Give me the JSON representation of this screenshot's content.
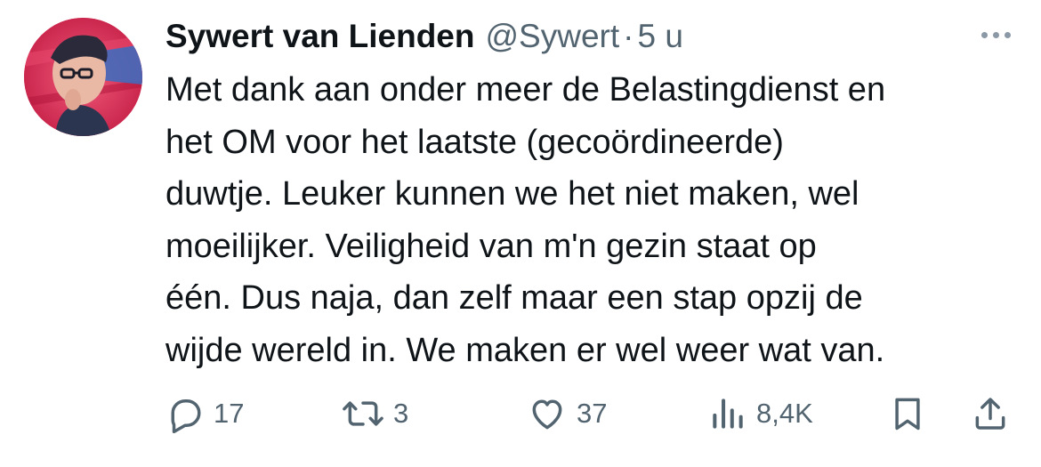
{
  "tweet": {
    "author_name": "Sywert van Lienden",
    "handle": "@Sywert",
    "separator": "·",
    "time": "5 u",
    "text_lines": [
      "Met dank aan onder meer de Belastingdienst en",
      "het OM voor het laatste (gecoördineerde)",
      "duwtje. Leuker kunnen we het niet maken, wel",
      "moeilijker. Veiligheid van m'n gezin staat op",
      "één. Dus naja, dan zelf maar een stap opzij de",
      "wijde wereld in. We maken er wel weer wat van."
    ]
  },
  "actions": {
    "replies": "17",
    "reposts": "3",
    "likes": "37",
    "views": "8,4K"
  },
  "icons": {
    "reply": "reply-icon",
    "repost": "repost-icon",
    "like": "like-icon",
    "views": "views-icon",
    "bookmark": "bookmark-icon",
    "share": "share-icon",
    "more": "more-icon"
  },
  "colors": {
    "text": "#0f1419",
    "secondary": "#536471",
    "avatar_bg": "#d8284e"
  }
}
